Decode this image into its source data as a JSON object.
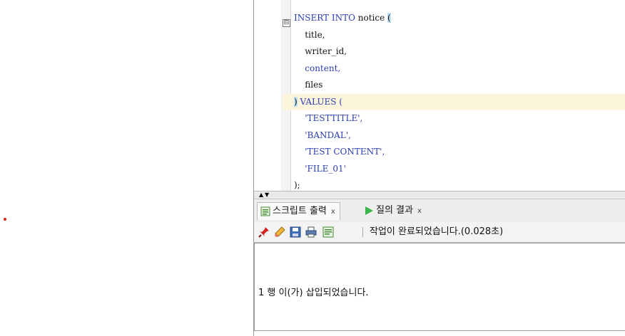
{
  "editor": {
    "lines": [
      {
        "parts": [
          {
            "t": "INSERT INTO",
            "c": "kw"
          },
          {
            "t": " notice ",
            "c": ""
          },
          {
            "t": "(",
            "c": "paren-hl"
          }
        ]
      },
      {
        "parts": [
          {
            "t": "    title,",
            "c": ""
          }
        ]
      },
      {
        "parts": [
          {
            "t": "    writer_id,",
            "c": ""
          }
        ]
      },
      {
        "parts": [
          {
            "t": "    content,",
            "c": "kw"
          }
        ]
      },
      {
        "parts": [
          {
            "t": "    files",
            "c": ""
          }
        ]
      },
      {
        "parts": [
          {
            "t": ")",
            "c": "paren-hl"
          },
          {
            "t": " VALUES (",
            "c": "kw"
          }
        ],
        "highlight": true
      },
      {
        "parts": [
          {
            "t": "    'TESTTITLE',",
            "c": "str"
          }
        ]
      },
      {
        "parts": [
          {
            "t": "    'BANDAL',",
            "c": "str"
          }
        ]
      },
      {
        "parts": [
          {
            "t": "    'TEST CONTENT',",
            "c": "str"
          }
        ]
      },
      {
        "parts": [
          {
            "t": "    'FILE_01'",
            "c": "str"
          }
        ]
      },
      {
        "parts": [
          {
            "t": ");",
            "c": ""
          }
        ]
      }
    ],
    "fold_symbol": "⊟"
  },
  "split_arrows": {
    "up": "▲",
    "down": "▼"
  },
  "tabs": [
    {
      "label": "스크립트 출력",
      "close": "x",
      "icon": "script-output-icon"
    },
    {
      "label": "질의 결과",
      "close": "x",
      "icon": "run-icon"
    }
  ],
  "toolbar": {
    "icons": [
      "pin-icon",
      "eraser-icon",
      "save-icon",
      "print-icon",
      "script-output-icon"
    ],
    "status": "작업이 완료되었습니다.(0.028초)"
  },
  "output": {
    "message": "1 행 이(가) 삽입되었습니다."
  },
  "colors": {
    "keyword": "#2a3db1",
    "current_line": "#fdf5dc",
    "bracket_match": "#bfe2f6"
  }
}
